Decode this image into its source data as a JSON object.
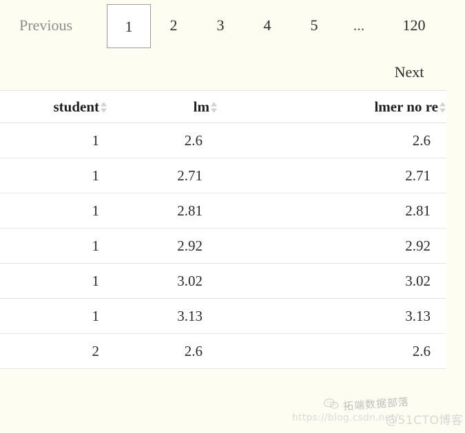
{
  "pagination": {
    "previous_label": "Previous",
    "next_label": "Next",
    "ellipsis": "...",
    "pages": [
      "1",
      "2",
      "3",
      "4",
      "5"
    ],
    "last_page": "120",
    "active_page": "1",
    "active_border_color": "#9b9b9b",
    "disabled_color": "#8d8d8d"
  },
  "table": {
    "columns": [
      {
        "label": "student",
        "sort_icon": "sort-updown-icon"
      },
      {
        "label": "lm",
        "sort_icon": "sort-updown-icon"
      },
      {
        "label": "lmer no re",
        "sort_icon": "sort-updown-icon"
      }
    ],
    "rows": [
      {
        "student": "1",
        "lm": "2.6",
        "lmer_no_re": "2.6"
      },
      {
        "student": "1",
        "lm": "2.71",
        "lmer_no_re": "2.71"
      },
      {
        "student": "1",
        "lm": "2.81",
        "lmer_no_re": "2.81"
      },
      {
        "student": "1",
        "lm": "2.92",
        "lmer_no_re": "2.92"
      },
      {
        "student": "1",
        "lm": "3.02",
        "lmer_no_re": "3.02"
      },
      {
        "student": "1",
        "lm": "3.13",
        "lmer_no_re": "3.13"
      },
      {
        "student": "2",
        "lm": "2.6",
        "lmer_no_re": "2.6"
      }
    ]
  },
  "watermark": {
    "brand": "拓端数据部落",
    "url": "https://blog.csdn.net/",
    "cto": "@51CTO博客",
    "logo_icon": "wechat-icon"
  },
  "theme": {
    "page_background": "#fdfdf2",
    "table_background": "#ffffff",
    "row_border": "#e6e6e6",
    "text_color": "#2a2a2a"
  }
}
